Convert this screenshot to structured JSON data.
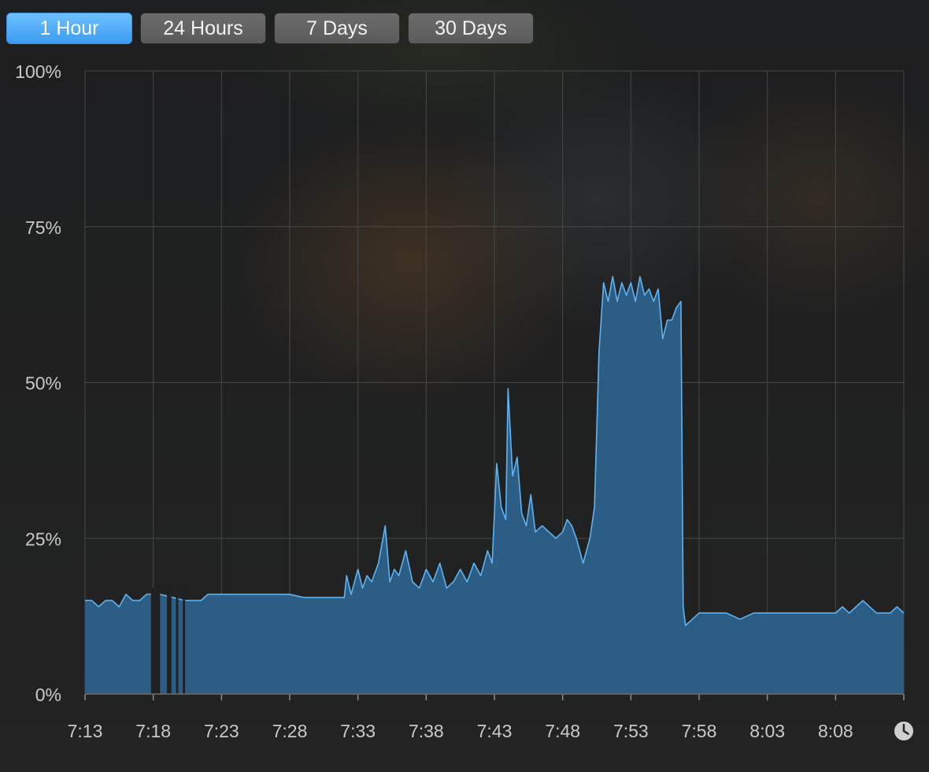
{
  "toolbar": {
    "ranges": [
      {
        "label": "1 Hour",
        "active": true
      },
      {
        "label": "24 Hours",
        "active": false
      },
      {
        "label": "7 Days",
        "active": false
      },
      {
        "label": "30 Days",
        "active": false
      }
    ]
  },
  "colors": {
    "fill": "#2c5d85",
    "line": "#5fb3f2",
    "grid": "#474747",
    "accent": "#4aa8f7"
  },
  "icons": {
    "time_icon": "clock-icon"
  },
  "chart_data": {
    "type": "area",
    "ylim": [
      0,
      100
    ],
    "yticks": [
      0,
      25,
      50,
      75,
      100
    ],
    "ytick_labels": [
      "0%",
      "25%",
      "50%",
      "75%",
      "100%"
    ],
    "xlim": [
      "7:13",
      "8:13"
    ],
    "xtick_labels": [
      "7:13",
      "7:18",
      "7:23",
      "7:28",
      "7:33",
      "7:38",
      "7:43",
      "7:48",
      "7:53",
      "7:58",
      "8:03",
      "8:08"
    ],
    "gaps": [
      [
        "7:17:50",
        "7:18:30"
      ],
      [
        "7:19:00",
        "7:19:20"
      ],
      [
        "7:19:40",
        "7:19:50"
      ],
      [
        "7:20:10",
        "7:20:20"
      ]
    ],
    "series": [
      {
        "x": [
          "7:13:00",
          "7:13:30",
          "7:14:00",
          "7:14:30",
          "7:15:00",
          "7:15:30",
          "7:16:00",
          "7:16:30",
          "7:17:00",
          "7:17:30",
          "7:18:30",
          "7:20:20",
          "7:21:00",
          "7:21:30",
          "7:22:00",
          "7:23:00",
          "7:24:00",
          "7:25:00",
          "7:26:00",
          "7:27:00",
          "7:28:00",
          "7:29:00",
          "7:30:00",
          "7:31:00",
          "7:32:00",
          "7:32:10",
          "7:32:30",
          "7:33:00",
          "7:33:20",
          "7:33:40",
          "7:34:00",
          "7:34:30",
          "7:35:00",
          "7:35:20",
          "7:35:40",
          "7:36:00",
          "7:36:30",
          "7:37:00",
          "7:37:30",
          "7:38:00",
          "7:38:30",
          "7:39:00",
          "7:39:30",
          "7:40:00",
          "7:40:30",
          "7:41:00",
          "7:41:30",
          "7:42:00",
          "7:42:30",
          "7:42:50",
          "7:43:10",
          "7:43:30",
          "7:43:50",
          "7:44:00",
          "7:44:20",
          "7:44:40",
          "7:45:00",
          "7:45:20",
          "7:45:40",
          "7:46:00",
          "7:46:30",
          "7:47:00",
          "7:47:30",
          "7:48:00",
          "7:48:20",
          "7:48:40",
          "7:49:00",
          "7:49:30",
          "7:50:00",
          "7:50:20",
          "7:50:40",
          "7:51:00",
          "7:51:20",
          "7:51:40",
          "7:52:00",
          "7:52:20",
          "7:52:40",
          "7:53:00",
          "7:53:20",
          "7:53:40",
          "7:54:00",
          "7:54:20",
          "7:54:40",
          "7:55:00",
          "7:55:20",
          "7:55:40",
          "7:56:00",
          "7:56:20",
          "7:56:40",
          "7:56:50",
          "7:57:00",
          "7:57:30",
          "7:58:00",
          "7:59:00",
          "8:00:00",
          "8:01:00",
          "8:02:00",
          "8:03:00",
          "8:04:00",
          "8:05:00",
          "8:06:00",
          "8:07:00",
          "8:08:00",
          "8:08:30",
          "8:09:00",
          "8:10:00",
          "8:11:00",
          "8:12:00",
          "8:12:30",
          "8:13:00"
        ],
        "values": [
          15,
          15,
          14,
          15,
          15,
          14,
          16,
          15,
          15,
          16,
          16,
          15,
          15,
          15,
          16,
          16,
          16,
          16,
          16,
          16,
          16,
          15.5,
          15.5,
          15.5,
          15.5,
          19,
          16,
          20,
          17,
          19,
          18,
          21,
          27,
          18,
          20,
          19,
          23,
          18,
          17,
          20,
          18,
          21,
          17,
          18,
          20,
          18,
          21,
          19,
          23,
          21,
          37,
          30,
          28,
          49,
          35,
          38,
          29,
          27,
          32,
          26,
          27,
          26,
          25,
          26,
          28,
          27,
          25,
          21,
          25,
          30,
          55,
          66,
          63,
          67,
          63,
          66,
          64,
          66,
          63,
          67,
          64,
          65,
          63,
          65,
          57,
          60,
          60,
          62,
          63,
          14,
          11,
          12,
          13,
          13,
          13,
          12,
          13,
          13,
          13,
          13,
          13,
          13,
          13,
          14,
          13,
          15,
          13,
          13,
          14,
          13
        ]
      }
    ]
  }
}
